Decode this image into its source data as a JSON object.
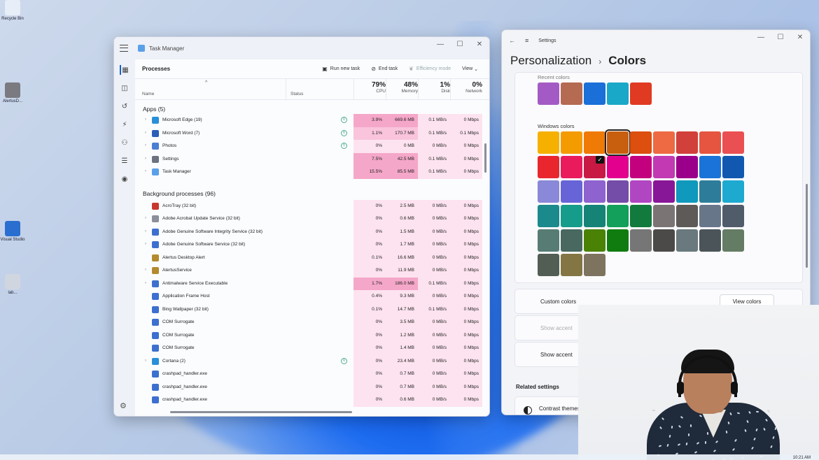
{
  "desktop": {
    "icons": [
      {
        "label": "Recycle Bin",
        "color": "#e8eef7"
      },
      {
        "label": "AlertusD...",
        "color": "#7a7a80"
      },
      {
        "label": "Visual Studio",
        "color": "#2a6fd0"
      },
      {
        "label": "lab...",
        "color": "#d0d6e0"
      }
    ]
  },
  "task_manager": {
    "title": "Task Manager",
    "page": "Processes",
    "toolbar": {
      "run": "Run new task",
      "end": "End task",
      "eff": "Efficiency mode",
      "view": "View"
    },
    "columns": {
      "name": "Name",
      "status": "Status",
      "cpu": {
        "pct": "79%",
        "label": "CPU"
      },
      "memory": {
        "pct": "48%",
        "label": "Memory"
      },
      "disk": {
        "pct": "1%",
        "label": "Disk"
      },
      "network": {
        "pct": "0%",
        "label": "Network"
      }
    },
    "groups": {
      "apps": "Apps (5)",
      "background": "Background processes (96)"
    },
    "apps": [
      {
        "name": "Microsoft Edge (19)",
        "cpu": "3.9%",
        "mem": "669.6 MB",
        "disk": "0.1 MB/s",
        "net": "0 Mbps",
        "icon": "edge-icon",
        "color": "#2a8fd8",
        "heat": "hi",
        "status": true
      },
      {
        "name": "Microsoft Word (7)",
        "cpu": "1.1%",
        "mem": "170.7 MB",
        "disk": "0.1 MB/s",
        "net": "0.1 Mbps",
        "icon": "word-icon",
        "color": "#2b5eb8",
        "heat": "mid",
        "status": true
      },
      {
        "name": "Photos",
        "cpu": "0%",
        "mem": "0 MB",
        "disk": "0 MB/s",
        "net": "0 Mbps",
        "icon": "photos-icon",
        "color": "#4b7fd4",
        "heat": "lo",
        "status": true
      },
      {
        "name": "Settings",
        "cpu": "7.5%",
        "mem": "42.5 MB",
        "disk": "0.1 MB/s",
        "net": "0 Mbps",
        "icon": "gear-icon",
        "color": "#6b7280",
        "heat": "hi",
        "status": false
      },
      {
        "name": "Task Manager",
        "cpu": "15.5%",
        "mem": "85.5 MB",
        "disk": "0.1 MB/s",
        "net": "0 Mbps",
        "icon": "taskmanager-icon",
        "color": "#5aa0e8",
        "heat": "hi",
        "status": false
      }
    ],
    "background": [
      {
        "name": "AcroTray (32 bit)",
        "cpu": "0%",
        "mem": "2.5 MB",
        "disk": "0 MB/s",
        "net": "0 Mbps",
        "color": "#c8372d",
        "expand": false
      },
      {
        "name": "Adobe Acrobat Update Service (32 bit)",
        "cpu": "0%",
        "mem": "0.6 MB",
        "disk": "0 MB/s",
        "net": "0 Mbps",
        "color": "#8a8f99",
        "expand": true
      },
      {
        "name": "Adobe Genuine Software Integrity Service (32 bit)",
        "cpu": "0%",
        "mem": "1.5 MB",
        "disk": "0 MB/s",
        "net": "0 Mbps",
        "color": "#3c6fcf",
        "expand": true
      },
      {
        "name": "Adobe Genuine Software Service (32 bit)",
        "cpu": "0%",
        "mem": "1.7 MB",
        "disk": "0 MB/s",
        "net": "0 Mbps",
        "color": "#3c6fcf",
        "expand": true
      },
      {
        "name": "Alertus Desktop Alert",
        "cpu": "0.1%",
        "mem": "16.6 MB",
        "disk": "0 MB/s",
        "net": "0 Mbps",
        "color": "#b38a2d",
        "expand": false
      },
      {
        "name": "AlertusService",
        "cpu": "0%",
        "mem": "11.9 MB",
        "disk": "0 MB/s",
        "net": "0 Mbps",
        "color": "#b38a2d",
        "expand": true
      },
      {
        "name": "Antimalware Service Executable",
        "cpu": "1.7%",
        "mem": "186.0 MB",
        "disk": "0.1 MB/s",
        "net": "0 Mbps",
        "color": "#3c6fcf",
        "expand": true,
        "heat": "hi"
      },
      {
        "name": "Application Frame Host",
        "cpu": "0.4%",
        "mem": "9.3 MB",
        "disk": "0 MB/s",
        "net": "0 Mbps",
        "color": "#3c6fcf",
        "expand": false
      },
      {
        "name": "Bing Wallpaper (32 bit)",
        "cpu": "0.1%",
        "mem": "14.7 MB",
        "disk": "0.1 MB/s",
        "net": "0 Mbps",
        "color": "#3c6fcf",
        "expand": false
      },
      {
        "name": "COM Surrogate",
        "cpu": "0%",
        "mem": "3.5 MB",
        "disk": "0 MB/s",
        "net": "0 Mbps",
        "color": "#3c6fcf",
        "expand": false
      },
      {
        "name": "COM Surrogate",
        "cpu": "0%",
        "mem": "1.2 MB",
        "disk": "0 MB/s",
        "net": "0 Mbps",
        "color": "#3c6fcf",
        "expand": false
      },
      {
        "name": "COM Surrogate",
        "cpu": "0%",
        "mem": "1.4 MB",
        "disk": "0 MB/s",
        "net": "0 Mbps",
        "color": "#3c6fcf",
        "expand": false
      },
      {
        "name": "Cortana (2)",
        "cpu": "0%",
        "mem": "23.4 MB",
        "disk": "0 MB/s",
        "net": "0 Mbps",
        "color": "#2a8fd8",
        "expand": true,
        "status": true
      },
      {
        "name": "crashpad_handler.exe",
        "cpu": "0%",
        "mem": "0.7 MB",
        "disk": "0 MB/s",
        "net": "0 Mbps",
        "color": "#3c6fcf",
        "expand": false
      },
      {
        "name": "crashpad_handler.exe",
        "cpu": "0%",
        "mem": "0.7 MB",
        "disk": "0 MB/s",
        "net": "0 Mbps",
        "color": "#3c6fcf",
        "expand": false
      },
      {
        "name": "crashpad_handler.exe",
        "cpu": "0%",
        "mem": "0.6 MB",
        "disk": "0 MB/s",
        "net": "0 Mbps",
        "color": "#3c6fcf",
        "expand": false
      }
    ]
  },
  "settings": {
    "title": "Settings",
    "breadcrumb": {
      "parent": "Personalization",
      "current": "Colors"
    },
    "recent_label": "Recent colors",
    "recent_colors": [
      "#a45ac4",
      "#b56a52",
      "#1a6fd8",
      "#1aa8c8",
      "#e03a22"
    ],
    "windows_label": "Windows colors",
    "windows_colors": [
      "#f6b000",
      "#f49b00",
      "#ef7a05",
      "#c85f0e",
      "#dc4f0f",
      "#ee6a42",
      "#d1403a",
      "#e6553f",
      "#ea5052",
      "#e9262e",
      "#ea1b5d",
      "#c81945",
      "#e3008f",
      "#c3007e",
      "#c239b3",
      "#9a0089",
      "#1a73d8",
      "#1159b0",
      "#8a88d8",
      "#6764d8",
      "#8e62cf",
      "#744da9",
      "#b146c2",
      "#881798",
      "#0f99bc",
      "#2d7d9a",
      "#1eaad0",
      "#1a8a8c",
      "#169c8a",
      "#158476",
      "#12a05a",
      "#127a3c",
      "#7a7574",
      "#5d5a58",
      "#68768a",
      "#515c6b",
      "#567c73",
      "#486860",
      "#498205",
      "#107c10",
      "#767676",
      "#4c4a48",
      "#69797e",
      "#4a5459",
      "#647c64",
      "#525e54",
      "#847545",
      "#7e735f"
    ],
    "selected_index": 3,
    "checked_index": 11,
    "custom_colors": "Custom colors",
    "view_colors": "View colors",
    "show_accent_1": "Show accent",
    "show_accent_2": "Show accent",
    "related": "Related settings",
    "contrast": "Contrast themes"
  },
  "taskbar": {
    "time": "10:21 AM"
  }
}
